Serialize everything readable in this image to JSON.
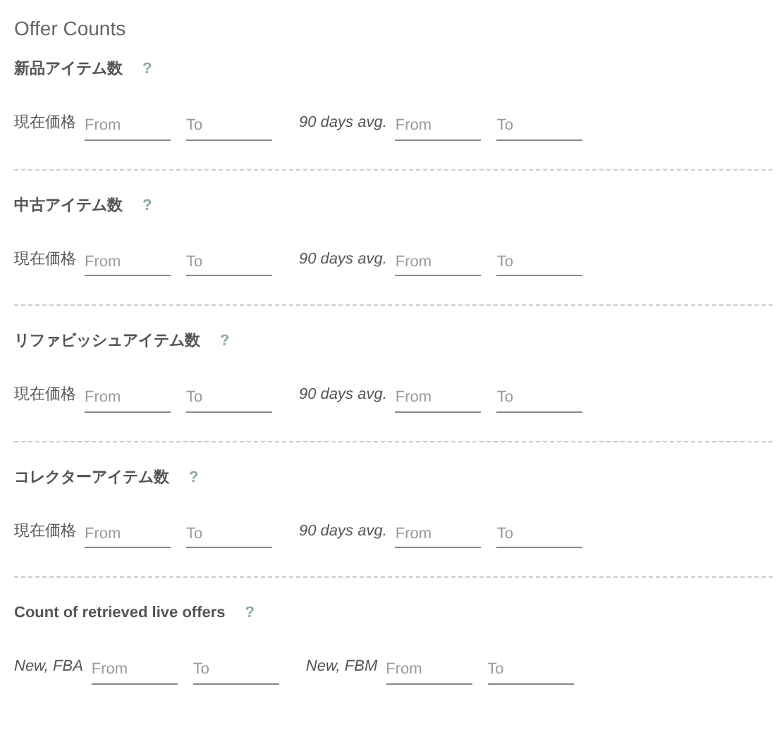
{
  "title": "Offer Counts",
  "sections": [
    {
      "heading": "新品アイテム数",
      "help": "?",
      "groups": [
        {
          "label": "現在価格",
          "kind": "plain",
          "fields": [
            {
              "placeholder": "From"
            },
            {
              "placeholder": "To"
            }
          ]
        },
        {
          "label": "90 days avg.",
          "kind": "italic",
          "fields": [
            {
              "placeholder": "From"
            },
            {
              "placeholder": "To"
            }
          ]
        }
      ]
    },
    {
      "heading": "中古アイテム数",
      "help": "?",
      "groups": [
        {
          "label": "現在価格",
          "kind": "plain",
          "fields": [
            {
              "placeholder": "From"
            },
            {
              "placeholder": "To"
            }
          ]
        },
        {
          "label": "90 days avg.",
          "kind": "italic",
          "fields": [
            {
              "placeholder": "From"
            },
            {
              "placeholder": "To"
            }
          ]
        }
      ]
    },
    {
      "heading": "リファビッシュアイテム数",
      "help": "?",
      "groups": [
        {
          "label": "現在価格",
          "kind": "plain",
          "fields": [
            {
              "placeholder": "From"
            },
            {
              "placeholder": "To"
            }
          ]
        },
        {
          "label": "90 days avg.",
          "kind": "italic",
          "fields": [
            {
              "placeholder": "From"
            },
            {
              "placeholder": "To"
            }
          ]
        }
      ]
    },
    {
      "heading": "コレクターアイテム数",
      "help": "?",
      "groups": [
        {
          "label": "現在価格",
          "kind": "plain",
          "fields": [
            {
              "placeholder": "From"
            },
            {
              "placeholder": "To"
            }
          ]
        },
        {
          "label": "90 days avg.",
          "kind": "italic",
          "fields": [
            {
              "placeholder": "From"
            },
            {
              "placeholder": "To"
            }
          ]
        }
      ]
    },
    {
      "heading": "Count of retrieved live offers",
      "help": "?",
      "groups": [
        {
          "label": "New, FBA",
          "kind": "italic",
          "fields": [
            {
              "placeholder": "From"
            },
            {
              "placeholder": "To"
            }
          ]
        },
        {
          "label": "New, FBM",
          "kind": "italic",
          "fields": [
            {
              "placeholder": "From"
            },
            {
              "placeholder": "To"
            }
          ]
        }
      ]
    }
  ]
}
